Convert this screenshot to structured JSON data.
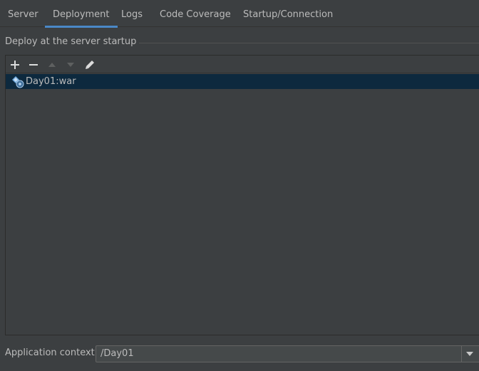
{
  "tabs": [
    {
      "label": "Server"
    },
    {
      "label": "Deployment"
    },
    {
      "label": "Logs"
    },
    {
      "label": "Code Coverage"
    },
    {
      "label": "Startup/Connection"
    }
  ],
  "active_tab": "Deployment",
  "deploy_section": {
    "title": "Deploy at the server startup",
    "toolbar": {
      "add_icon": "plus-icon",
      "remove_icon": "minus-icon",
      "move_up_icon": "arrow-up-icon",
      "move_down_icon": "arrow-down-icon",
      "edit_icon": "pencil-icon"
    },
    "items": [
      {
        "label": "Day01:war",
        "icon": "artifact-war-icon",
        "selected": true
      }
    ]
  },
  "application_context": {
    "label": "Application context:",
    "value": "/Day01"
  },
  "colors": {
    "background": "#3c3f41",
    "selection": "#0d293e",
    "accent": "#4a88c7",
    "text": "#bbbbbb"
  }
}
